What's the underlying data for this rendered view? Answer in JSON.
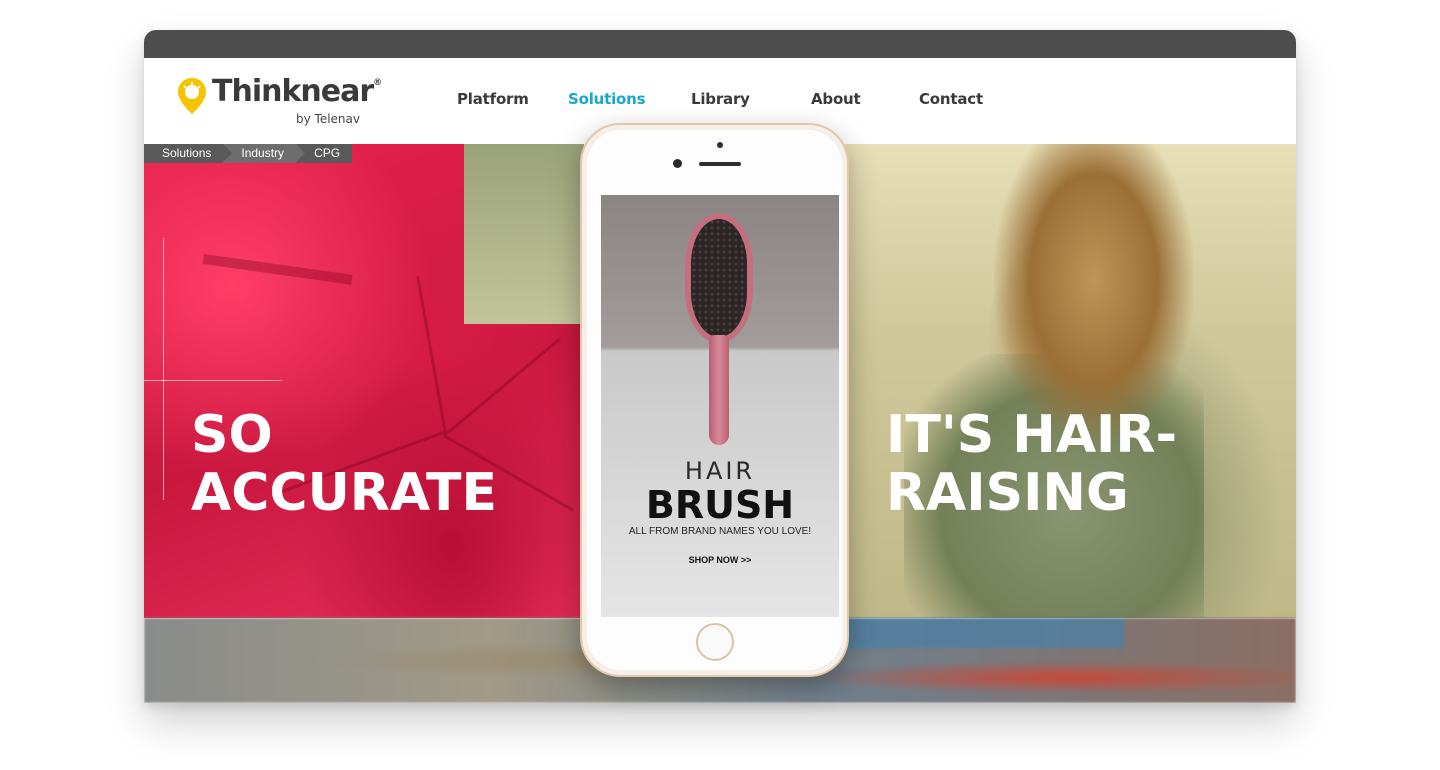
{
  "header": {
    "logo_text_think": "Think",
    "logo_text_near": "near",
    "logo_reg": "®",
    "logo_sub": "by Telenav",
    "logo_icon": "map-pin-bulb-icon",
    "logo_color": "#f5c400"
  },
  "nav": {
    "items": [
      {
        "label": "Platform",
        "active": false
      },
      {
        "label": "Solutions",
        "active": true
      },
      {
        "label": "Library",
        "active": false
      },
      {
        "label": "About",
        "active": false
      },
      {
        "label": "Contact",
        "active": false
      }
    ],
    "active_color": "#1aa7c9"
  },
  "breadcrumb": [
    "Solutions",
    "Industry",
    "CPG"
  ],
  "hero": {
    "left_line1": "SO",
    "left_line2": "ACCURATE",
    "right_line1": "IT'S HAIR-",
    "right_line2": "RAISING",
    "accent_color": "#e7234d"
  },
  "phone_ad": {
    "title_small": "HAIR",
    "title_big": "BRUSH",
    "tagline": "ALL FROM BRAND NAMES YOU LOVE!",
    "cta": "SHOP NOW >>"
  }
}
